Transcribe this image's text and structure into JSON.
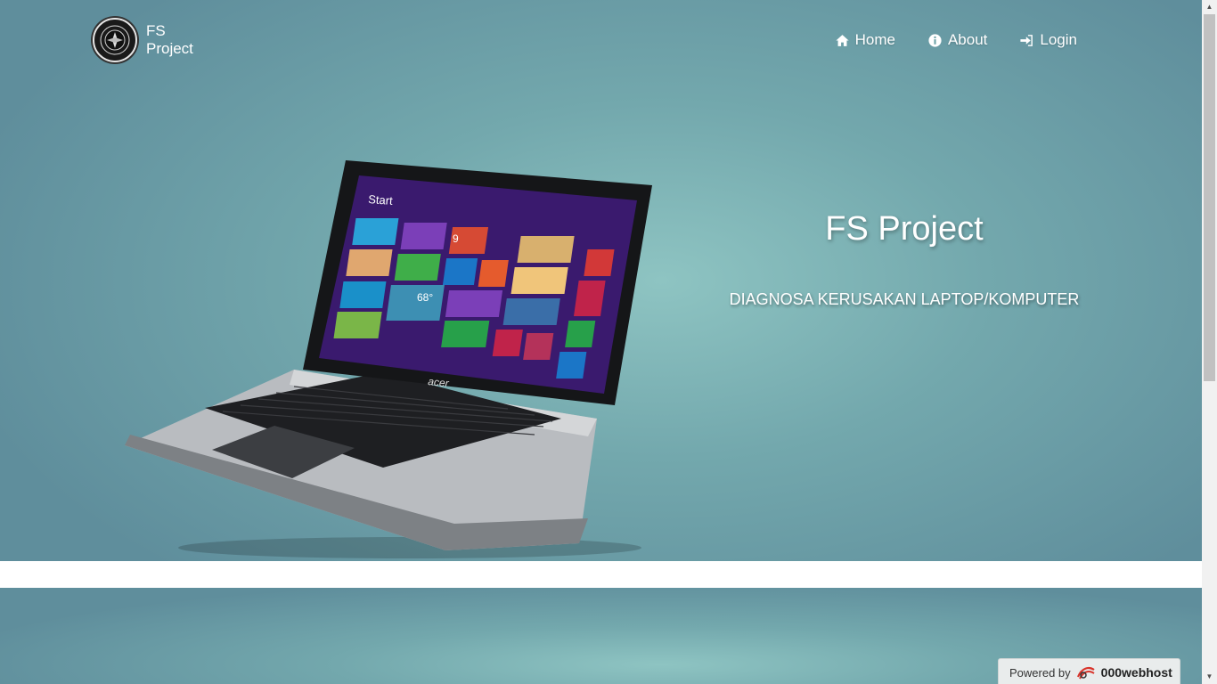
{
  "brand": {
    "name": "FS Project"
  },
  "nav": {
    "items": [
      {
        "label": "Home",
        "icon": "home-icon"
      },
      {
        "label": "About",
        "icon": "info-icon"
      },
      {
        "label": "Login",
        "icon": "sign-in-icon"
      }
    ]
  },
  "hero": {
    "title": "FS Project",
    "subtitle": "DIAGNOSA KERUSAKAN LAPTOP/KOMPUTER",
    "laptop_screen_start": "Start",
    "laptop_brand": "acer",
    "laptop_tile_temperature": "68°",
    "laptop_tile_date": "9"
  },
  "footer_badge": {
    "prefix": "Powered by",
    "name": "000webhost"
  },
  "colors": {
    "hero_light": "#8ec4c2",
    "hero_dark": "#5f8e9c"
  }
}
